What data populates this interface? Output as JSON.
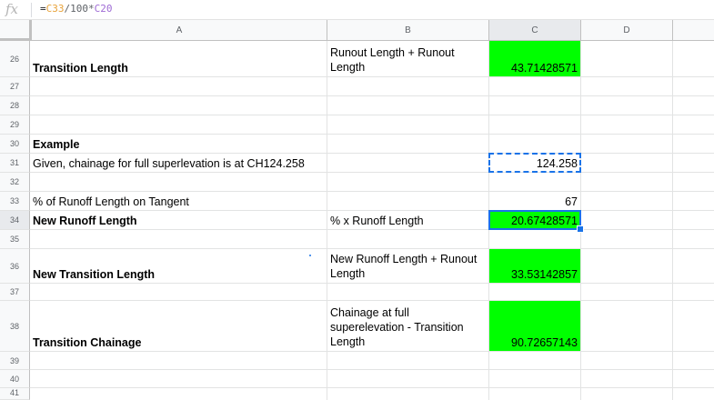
{
  "formula_bar": {
    "fx_label": "fx",
    "formula_prefix": "=",
    "ref1": "C33",
    "op1": "/100*",
    "ref2": "C20"
  },
  "columns": [
    "A",
    "B",
    "C",
    "D"
  ],
  "rows": [
    "26",
    "27",
    "28",
    "29",
    "30",
    "31",
    "32",
    "33",
    "34",
    "35",
    "36",
    "37",
    "38",
    "39",
    "40",
    "41"
  ],
  "cells": {
    "A26": "Transition Length",
    "B26": "Runout Length + Runout Length",
    "C26": "43.71428571",
    "A30": "Example",
    "A31": "Given, chainage for full superlevation is at CH124.258",
    "C31": "124.258",
    "A33": "% of Runoff Length on Tangent",
    "C33": "67",
    "A34": "New Runoff Length",
    "B34": "% x Runoff Length",
    "C34": "20.67428571",
    "A36": "New Transition Length",
    "B36": "New Runoff Length + Runout Length",
    "C36": "33.53142857",
    "A38": "Transition Chainage",
    "B38": "Chainage at full superelevation - Transition Length",
    "C38": "90.72657143"
  },
  "colors": {
    "highlight_green": "#00ff00",
    "selection_blue": "#1a73e8"
  }
}
